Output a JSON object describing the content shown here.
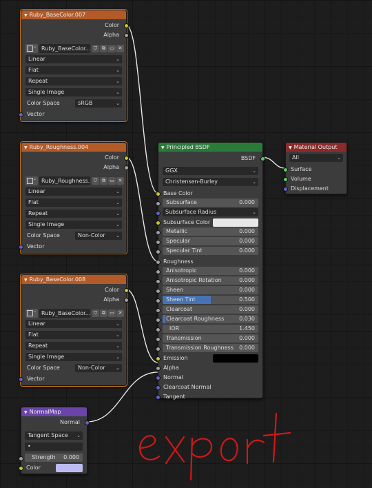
{
  "tex1": {
    "title": "Ruby_BaseColor.007",
    "out_color": "Color",
    "out_alpha": "Alpha",
    "image_name": "Ruby_BaseColor...",
    "interpolation": "Linear",
    "projection": "Flat",
    "extension": "Repeat",
    "source": "Single Image",
    "color_space_label": "Color Space",
    "color_space": "sRGB",
    "in_vector": "Vector"
  },
  "tex2": {
    "title": "Ruby_Roughness.004",
    "out_color": "Color",
    "out_alpha": "Alpha",
    "image_name": "Ruby_Roughness...",
    "interpolation": "Linear",
    "projection": "Flat",
    "extension": "Repeat",
    "source": "Single Image",
    "color_space_label": "Color Space",
    "color_space": "Non-Color",
    "in_vector": "Vector"
  },
  "tex3": {
    "title": "Ruby_BaseColor.008",
    "out_color": "Color",
    "out_alpha": "Alpha",
    "image_name": "Ruby_BaseColor...",
    "interpolation": "Linear",
    "projection": "Flat",
    "extension": "Repeat",
    "source": "Single Image",
    "color_space_label": "Color Space",
    "color_space": "Non-Color",
    "in_vector": "Vector"
  },
  "bsdf": {
    "title": "Principled BSDF",
    "out_bsdf": "BSDF",
    "distribution": "GGX",
    "subsurface_method": "Christensen-Burley",
    "base_color": "Base Color",
    "subsurface": {
      "label": "Subsurface",
      "value": "0.000"
    },
    "subsurface_radius": "Subsurface Radius",
    "subsurface_color": "Subsurface Color",
    "metallic": {
      "label": "Metallic",
      "value": "0.000"
    },
    "specular": {
      "label": "Specular",
      "value": "0.000"
    },
    "specular_tint": {
      "label": "Specular Tint",
      "value": "0.000"
    },
    "roughness": "Roughness",
    "anisotropic": {
      "label": "Anisotropic",
      "value": "0.000"
    },
    "anisotropic_rotation": {
      "label": "Anisotropic Rotation",
      "value": "0.000"
    },
    "sheen": {
      "label": "Sheen",
      "value": "0.000"
    },
    "sheen_tint": {
      "label": "Sheen Tint",
      "value": "0.500"
    },
    "clearcoat": {
      "label": "Clearcoat",
      "value": "0.000"
    },
    "clearcoat_roughness": {
      "label": "Clearcoat Roughness",
      "value": "0.030"
    },
    "ior": {
      "label": "IOR",
      "value": "1.450"
    },
    "transmission": {
      "label": "Transmission",
      "value": "0.000"
    },
    "transmission_roughness": {
      "label": "Transmission Roughness",
      "value": "0.000"
    },
    "emission": "Emission",
    "alpha": "Alpha",
    "normal": "Normal",
    "clearcoat_normal": "Clearcoat Normal",
    "tangent": "Tangent"
  },
  "output": {
    "title": "Material Output",
    "target": "All",
    "surface": "Surface",
    "volume": "Volume",
    "displacement": "Displacement"
  },
  "normalmap": {
    "title": "NormalMap",
    "out_normal": "Normal",
    "space": "Tangent Space",
    "uv": "•",
    "strength": {
      "label": "Strength",
      "value": "0.000"
    },
    "in_color": "Color"
  },
  "annotation": {
    "text": "export",
    "color": "#d01818"
  },
  "colors": {
    "image_header": "#b25a28",
    "bsdf_header": "#2a7a3a",
    "output_header": "#8b2a2a",
    "normalmap_header": "#6a44a8",
    "link": "#e6e6e6",
    "socket_color": "#c7c729",
    "socket_float": "#a1a1a1",
    "socket_vector": "#6363c7",
    "socket_shader": "#63c763"
  }
}
